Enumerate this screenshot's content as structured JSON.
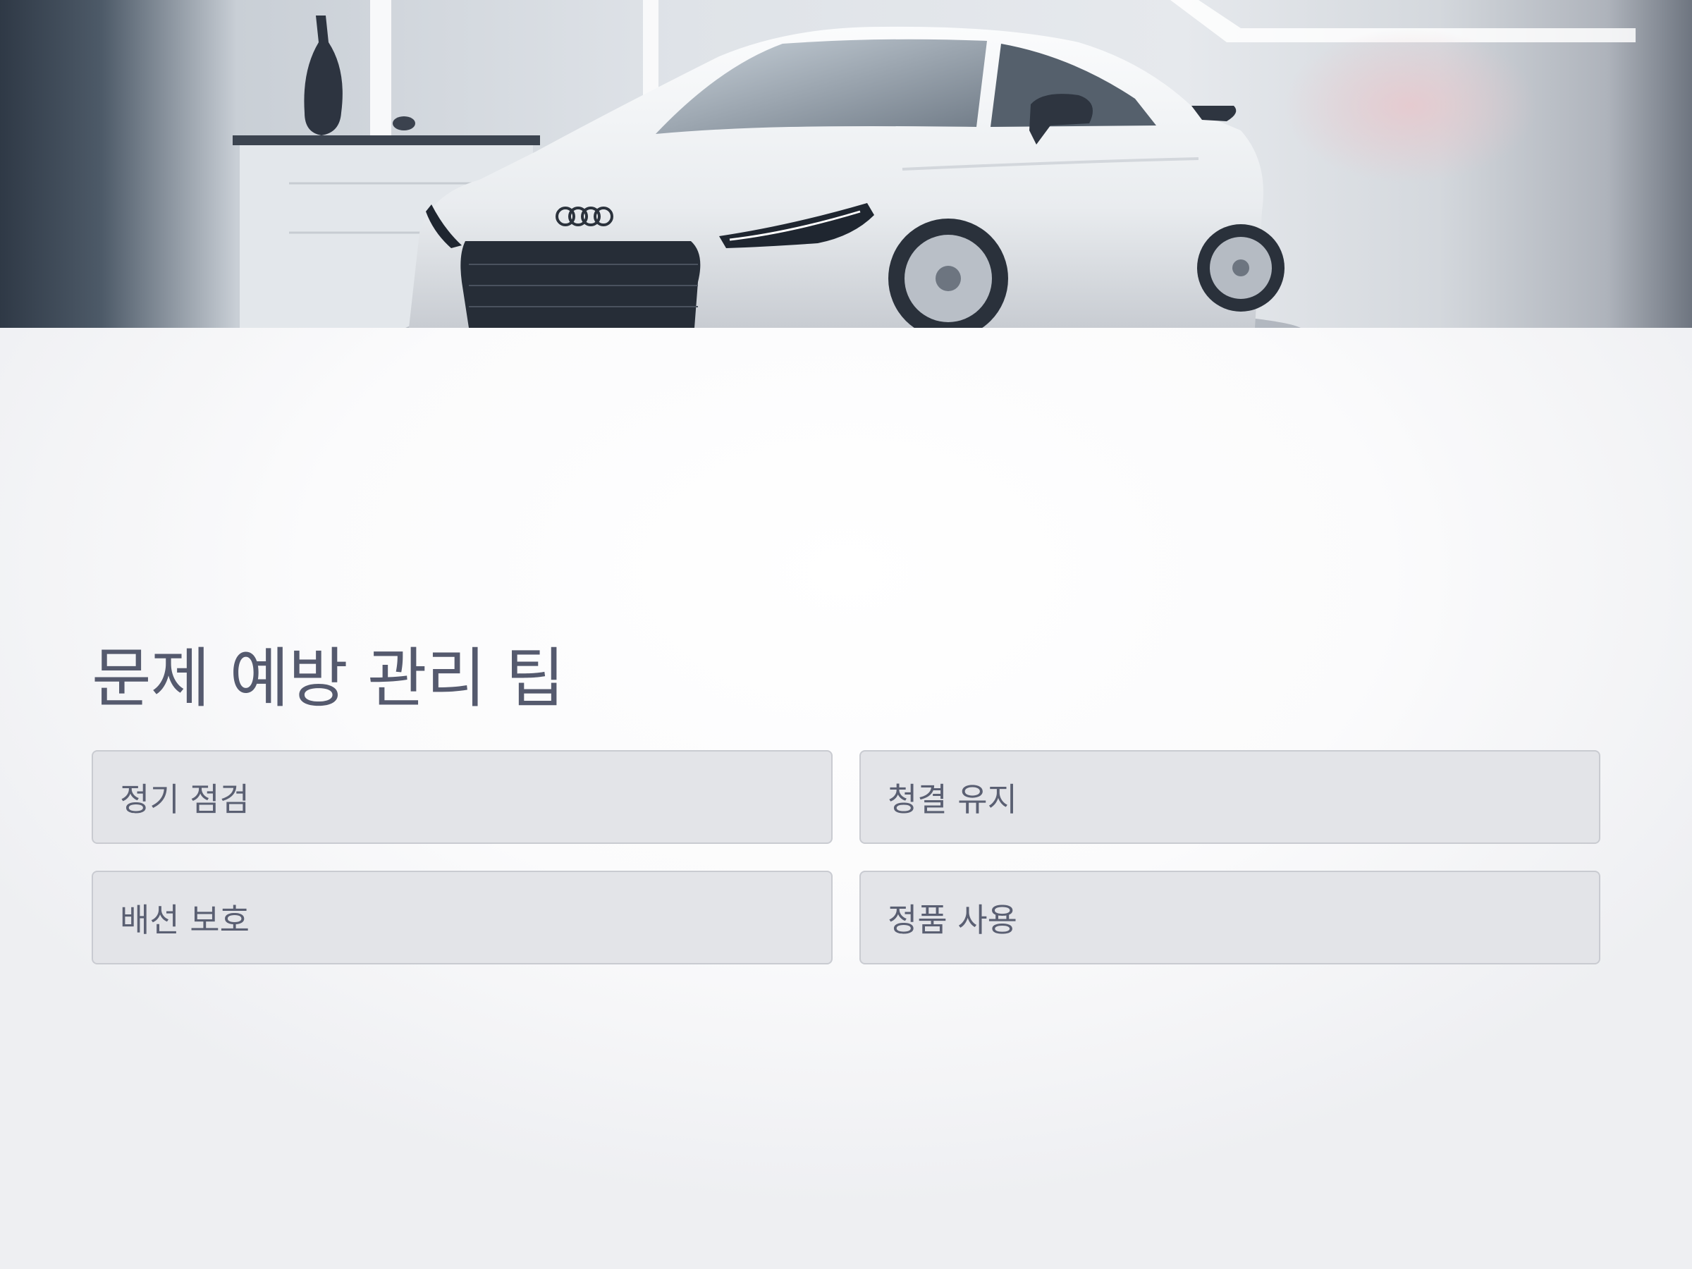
{
  "hero": {
    "image": "car-photo",
    "badge": "audi-logo"
  },
  "page": {
    "title": "문제 예방 관리 팁"
  },
  "tips": [
    {
      "label": "정기 점검"
    },
    {
      "label": "청결 유지"
    },
    {
      "label": "배선 보호"
    },
    {
      "label": "정품 사용"
    }
  ],
  "colors": {
    "background": "#fbfbfc",
    "title": "#555a6e",
    "card_bg": "#e3e4e8",
    "card_border": "#c9cbd1",
    "card_text": "#5a5f72"
  }
}
